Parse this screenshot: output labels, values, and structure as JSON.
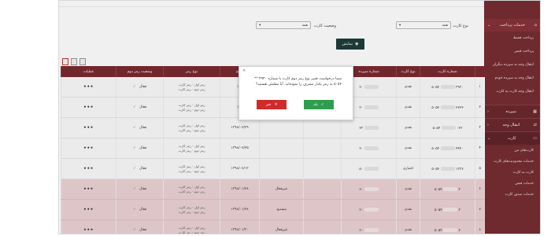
{
  "sidebar": {
    "main_section": "خدمات پرداخت",
    "main_items": [
      "پرداخت قسط",
      "پرداخت قبض",
      "انتقال وجه به سپرده دیگران",
      "انتقال وجه به سپرده خودم",
      "انتقال وجه کارت به کارت"
    ],
    "sections": [
      "سپرده",
      "انتقال وجه",
      "کارت"
    ],
    "card_items": [
      "کارت‌های من",
      "خدمات محدودیت‌های کارت",
      "کارت به کارت",
      "خدمات قبض",
      "خدمات صدور کارت"
    ]
  },
  "filters": {
    "card_type_label": "نوع کارت",
    "card_type_value": "همه",
    "card_status_label": "وضعیت کارت",
    "card_status_value": "همه",
    "show_button": "نمایش"
  },
  "table": {
    "headers": [
      "",
      "شماره کارت",
      "نوع کارت",
      "شماره سپرده",
      "",
      "",
      "تاریخ",
      "نوع رمز",
      "وضعیت رمز دوم",
      "عملیات"
    ],
    "rows": [
      {
        "num": "۱",
        "card_a": "۳۹۳۰",
        "card_b": "۵۰۵۴",
        "type": "نقدی",
        "dep": "۲۰",
        "status": "",
        "date": "۱۴۰",
        "pin1": "رمز اول - رمز کارت",
        "pin2": "رمز دوم - رمز کارت",
        "p2status": "فعال",
        "style": "white"
      },
      {
        "num": "۲",
        "card_a": "۲۲۲۴",
        "card_b": "۵۰۵۴",
        "type": "نقدی",
        "dep": "۲۰",
        "status": "",
        "date": "۱۴۰",
        "pin1": "رمز اول - رمز کارت",
        "pin2": "رمز دوم - رمز کارت",
        "p2status": "فعال",
        "style": "white"
      },
      {
        "num": "۳",
        "card_a": "۰۲۲",
        "card_b": "۵۰۵۴",
        "type": "نقدی",
        "dep": "۲۳",
        "status": "",
        "date": "۱۳۹۸/۰۷/۲۹",
        "pin1": "رمز اول - رمز کارت",
        "pin2": "رمز دوم - رمز کارت",
        "p2status": "فعال",
        "style": "white"
      },
      {
        "num": "۴",
        "card_a": "۴۴۴۰",
        "card_b": "۵۰۵۴",
        "type": "نقدی",
        "dep": "۲۰",
        "status": "",
        "date": "۱۳۹۸/۰۷/۲۵",
        "pin1": "رمز اول - رمز کارت",
        "pin2": "رمز دوم - رمز کارت",
        "p2status": "فعال",
        "style": "white"
      },
      {
        "num": "۵",
        "card_a": "۱۳۳۷",
        "card_b": "۵۰۵۴",
        "type": "اعتباری",
        "dep": "۵۰",
        "status": "",
        "date": "۱۳۹۸/۰۷/۱۳",
        "pin1": "رمز اول - رمز کارت",
        "pin2": "رمز دوم - رمز کارت",
        "p2status": "فعال",
        "style": "white"
      },
      {
        "num": "۶",
        "card_a": "۳",
        "card_b": "۵۰۵۴",
        "type": "نقدی",
        "dep": "۲۰",
        "status": "غیرفعال",
        "date": "۱۳۹۸/۰۱/۲۸",
        "pin1": "رمز اول - رمز کارت",
        "pin2": "رمز دوم - رمز کارت",
        "p2status": "فعال",
        "style": "pink"
      },
      {
        "num": "۷",
        "card_a": "۲",
        "card_b": "۵۰۵۴",
        "type": "نقدی",
        "dep": "۲۰",
        "status": "مسدود",
        "date": "۱۳۹۸/۰۱/۲۸",
        "pin1": "رمز اول - رمز کارت",
        "pin2": "رمز دوم - رمز کارت",
        "p2status": "فعال",
        "style": "pink"
      },
      {
        "num": "۸",
        "card_a": "۲",
        "card_b": "۵۰۵۴",
        "type": "نقدی",
        "dep": "۲۰",
        "status": "غیرفعال",
        "date": "۱۳۹۸/۰۱/۳۰",
        "pin1": "رمز اول - رمز کارت",
        "pin2": "رمز دوم - رمز کارت",
        "p2status": "فعال",
        "style": "pink"
      }
    ]
  },
  "dialog": {
    "message": "شما درخواست تغییر نوع رمز دوم کارت با شماره ۳۹۳۰ ** ۵۰۵۴ به رمز یکبار مصرف را نموده‌اید. آیا مطمئن هستید؟",
    "yes_label": "بله",
    "no_label": "خیر"
  }
}
